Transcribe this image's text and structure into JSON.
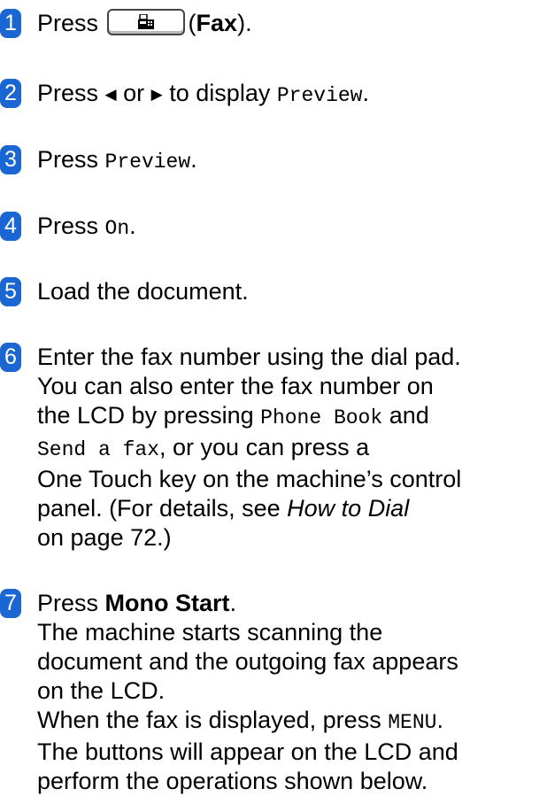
{
  "steps": [
    {
      "num": "1",
      "press": "Press",
      "open": "(",
      "fax": "Fax",
      "close": ")."
    },
    {
      "num": "2",
      "press": "Press",
      "left": "◀",
      "or": "or",
      "right": "▶",
      "to_display": "to display",
      "mono": "Preview",
      "dot": "."
    },
    {
      "num": "3",
      "press": "Press",
      "mono": "Preview",
      "dot": "."
    },
    {
      "num": "4",
      "press": "Press",
      "mono": "On",
      "dot": "."
    },
    {
      "num": "5",
      "text": "Load the document."
    },
    {
      "num": "6",
      "l1": "Enter the fax number using the dial pad.",
      "l2": "You can also enter the fax number on",
      "l3a": "the LCD by pressing",
      "l3mono": "Phone Book",
      "l3b": "and",
      "l4mono": "Send a fax",
      "l4b": ", or you can press a",
      "l5": "One Touch key on the machine’s control",
      "l6a": "panel. (For details, see",
      "l6italic": "How to Dial",
      "l7": "on page 72.)"
    },
    {
      "num": "7",
      "l1a": "Press",
      "l1bold": "Mono Start",
      "l1b": ".",
      "l2": "The machine starts scanning the",
      "l3": "document and the outgoing fax appears",
      "l4": "on the LCD.",
      "l5a": "When the fax is displayed, press",
      "l5mono": "MENU",
      "l5b": ".",
      "l6": "The buttons will appear on the LCD and",
      "l7": "perform the operations shown below."
    }
  ],
  "icons": {
    "fax_key": "fax-machine-icon",
    "badge_color": "#1a67d4"
  }
}
